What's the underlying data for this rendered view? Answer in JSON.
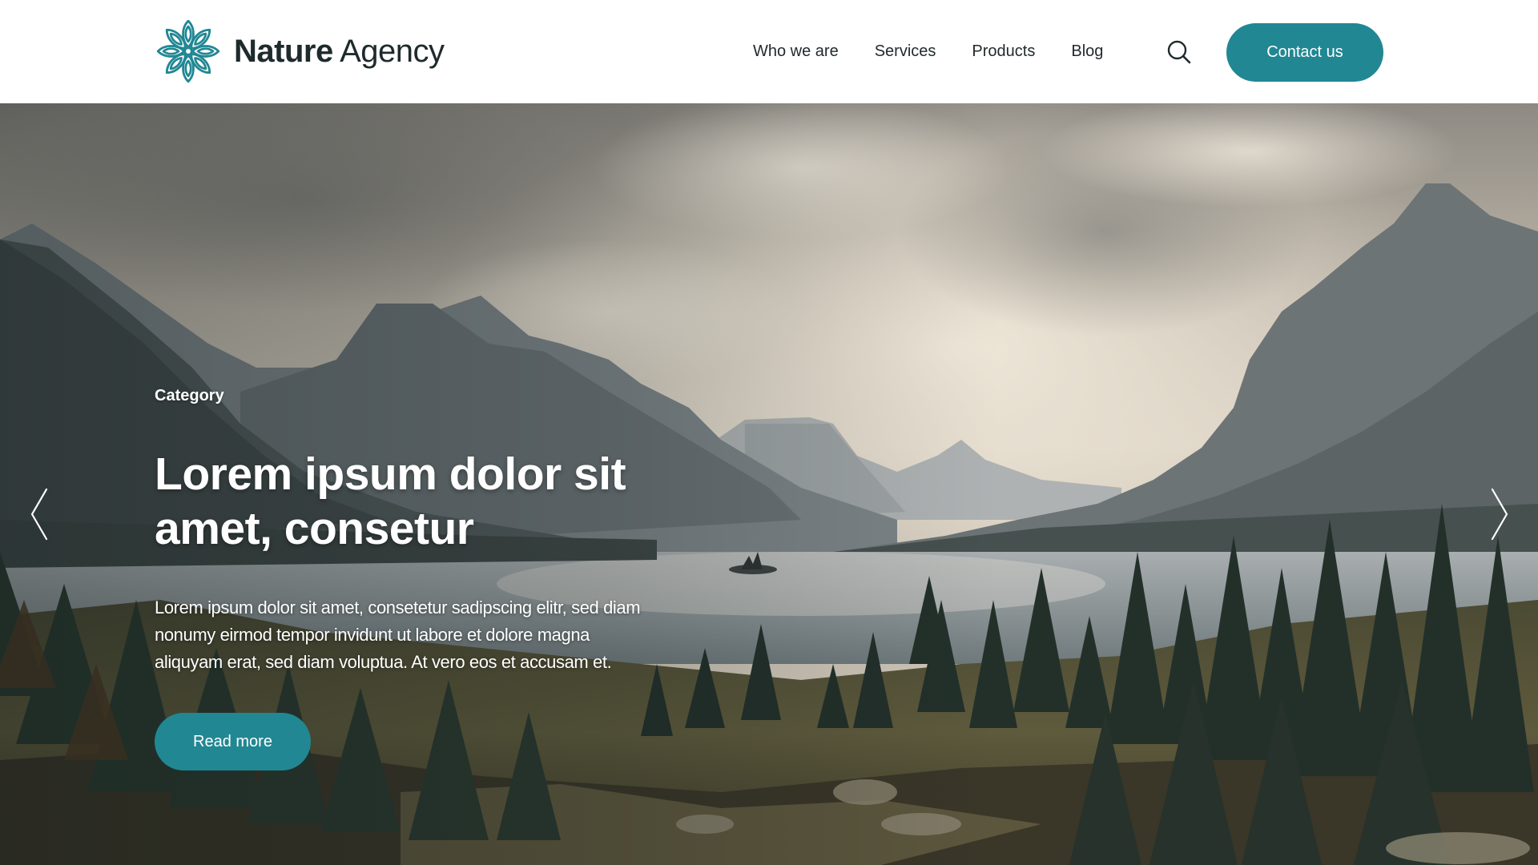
{
  "brand": {
    "name_bold": "Nature",
    "name_light": "Agency",
    "logo_icon": "flower-mandala-icon"
  },
  "nav": {
    "items": [
      {
        "label": "Who we are"
      },
      {
        "label": "Services"
      },
      {
        "label": "Products"
      },
      {
        "label": "Blog"
      }
    ],
    "search_icon": "search-icon",
    "contact_label": "Contact us"
  },
  "hero": {
    "category": "Category",
    "title_line1": "Lorem ipsum dolor sit",
    "title_line2": "amet, consetur",
    "text_line1": "Lorem ipsum dolor sit amet, consetetur sadipscing elitr, sed diam",
    "text_line2": "nonumy eirmod tempor invidunt ut labore et dolore magna",
    "text_line3": "aliquyam erat, sed diam voluptua. At vero eos et accusam et.",
    "read_more_label": "Read more",
    "prev_icon": "chevron-left-icon",
    "next_icon": "chevron-right-icon",
    "background": "mountain-lake-forest-photo"
  },
  "colors": {
    "accent": "#218793",
    "text_dark": "#1f2a2c",
    "white": "#ffffff"
  }
}
